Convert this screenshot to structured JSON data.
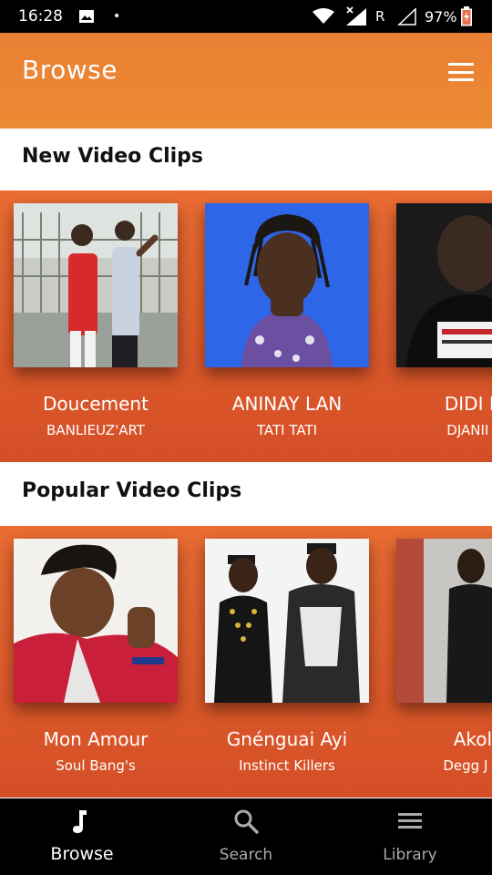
{
  "status_bar": {
    "time": "16:28",
    "notification_dot": "•",
    "network_letter": "R",
    "battery": "97%"
  },
  "app_bar": {
    "title": "Browse",
    "menu_icon": "hamburger-icon"
  },
  "sections": [
    {
      "title": "New Video Clips",
      "items": [
        {
          "title": "Doucement",
          "artist": "BANLIEUZ'ART"
        },
        {
          "title": "ANINAY LAN",
          "artist": "TATI TATI"
        },
        {
          "title": "DIDI LA",
          "artist": "DJANII AL"
        }
      ]
    },
    {
      "title": "Popular Video Clips",
      "items": [
        {
          "title": "Mon Amour",
          "artist": "Soul Bang's"
        },
        {
          "title": "Gnénguai Ayi",
          "artist": "Instinct Killers"
        },
        {
          "title": "Akolo",
          "artist": "Degg J For"
        }
      ]
    }
  ],
  "bottom_nav": [
    {
      "label": "Browse",
      "icon": "music-note-icon",
      "active": true
    },
    {
      "label": "Search",
      "icon": "search-icon",
      "active": false
    },
    {
      "label": "Library",
      "icon": "library-icon",
      "active": false
    }
  ],
  "colors": {
    "accent": "#ea7f33",
    "carousel_top": "#ea6d34",
    "carousel_bottom": "#d44e26"
  }
}
